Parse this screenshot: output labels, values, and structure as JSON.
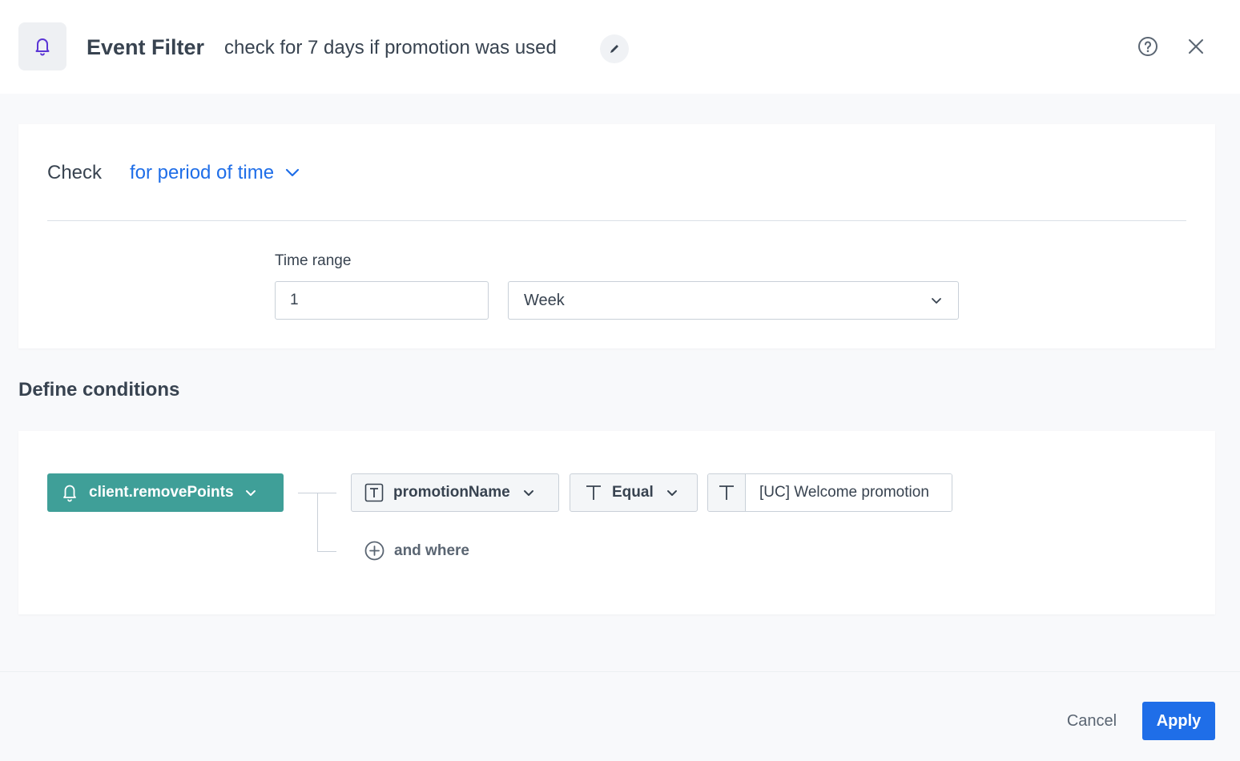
{
  "header": {
    "title": "Event Filter",
    "subtitle": "check for 7 days if promotion was used",
    "icon": "bell-icon"
  },
  "check": {
    "label": "Check",
    "mode": "for period of time"
  },
  "time_range": {
    "label": "Time range",
    "value": "1",
    "unit": "Week"
  },
  "conditions": {
    "title": "Define conditions",
    "event": "client.removePoints",
    "parameter": "promotionName",
    "operator": "Equal",
    "value": "[UC] Welcome promotion",
    "and_where": "and where"
  },
  "footer": {
    "cancel": "Cancel",
    "apply": "Apply"
  },
  "colors": {
    "accent": "#1f6ee8",
    "event_chip": "#3f9f98",
    "header_icon": "#5b35d5"
  }
}
